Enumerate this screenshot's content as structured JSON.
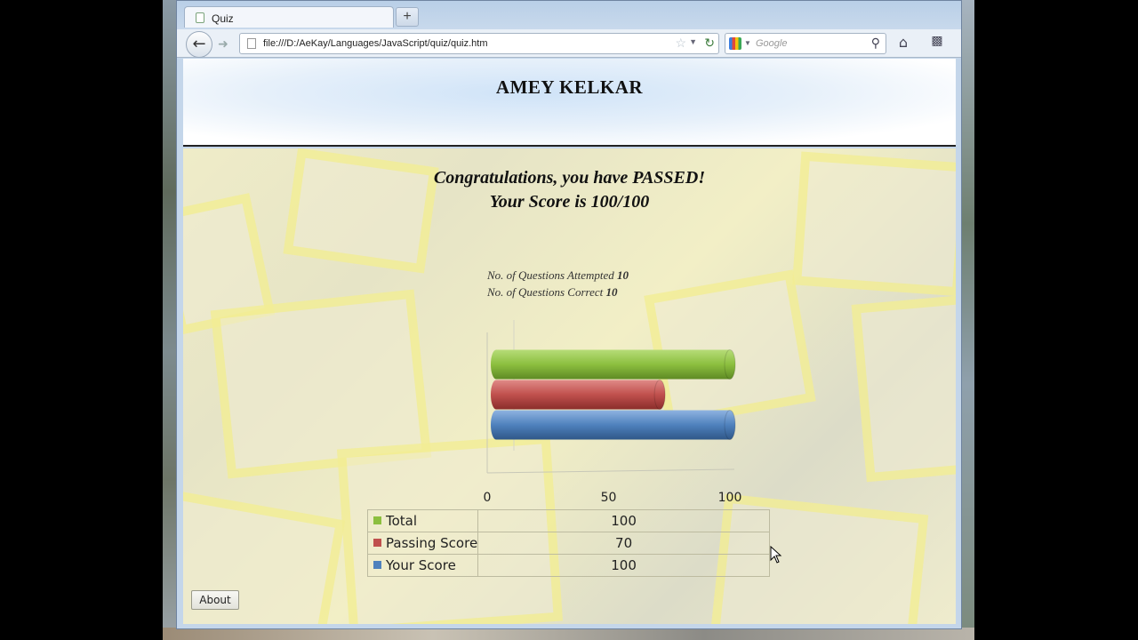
{
  "browser": {
    "tab_title": "Quiz",
    "new_tab_label": "+",
    "url": "file:///D:/AeKay/Languages/JavaScript/quiz/quiz.htm",
    "search_placeholder": "Google"
  },
  "page": {
    "site_title": "AMEY KELKAR",
    "result_line1": "Congratulations, you have PASSED!",
    "result_line2": "Your Score is 100/100",
    "attempted_label": "No. of Questions Attempted",
    "attempted_value": "10",
    "correct_label": "No. of Questions Correct",
    "correct_value": "10",
    "about_label": "About"
  },
  "chart_data": {
    "type": "bar",
    "orientation": "horizontal",
    "style": "3d-cylinder",
    "categories": [
      "Total",
      "Passing Score",
      "Your Score"
    ],
    "values": [
      100,
      70,
      100
    ],
    "colors": [
      "#8cbf3f",
      "#c0504d",
      "#4f81bd"
    ],
    "xlim": [
      0,
      100
    ],
    "ticks": [
      0,
      50,
      100
    ],
    "tick_labels": [
      "0",
      "50",
      "100"
    ],
    "legend_table": [
      {
        "name": "Total",
        "value": "100"
      },
      {
        "name": "Passing Score",
        "value": "70"
      },
      {
        "name": "Your Score",
        "value": "100"
      }
    ]
  }
}
